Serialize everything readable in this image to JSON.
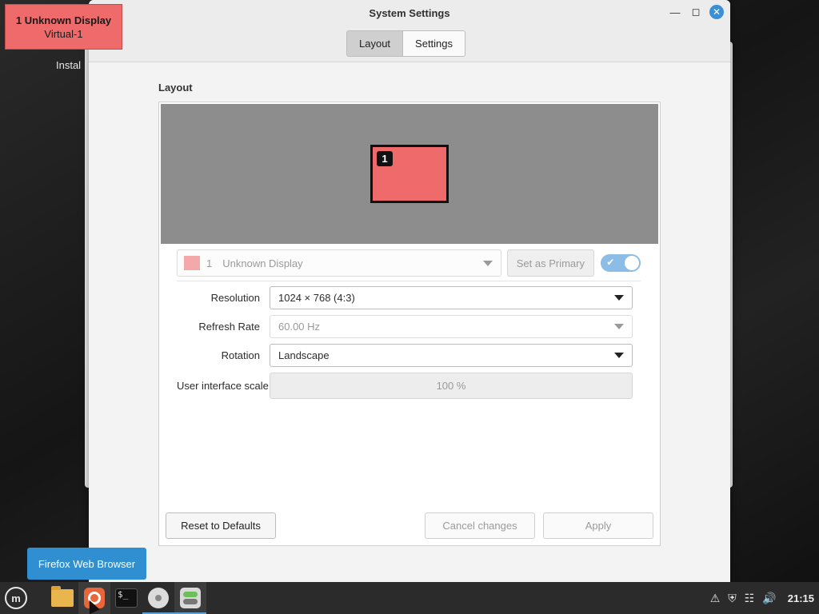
{
  "identify": {
    "title": "1  Unknown Display",
    "subtitle": "Virtual-1"
  },
  "desktop": {
    "background_label": "Instal"
  },
  "window": {
    "title": "System Settings",
    "tabs": [
      {
        "label": "Layout",
        "active": true
      },
      {
        "label": "Settings",
        "active": false
      }
    ]
  },
  "layout": {
    "section_title": "Layout",
    "monitor_number": "1",
    "display_selector": {
      "number": "1",
      "name": "Unknown Display",
      "swatch_color": "#f3a9a9"
    },
    "set_primary_label": "Set as Primary",
    "enabled": true,
    "fields": [
      {
        "label": "Resolution",
        "value": "1024 × 768 (4:3)",
        "enabled": true
      },
      {
        "label": "Refresh Rate",
        "value": "60.00 Hz",
        "enabled": false
      },
      {
        "label": "Rotation",
        "value": "Landscape",
        "enabled": true
      }
    ],
    "scale": {
      "label": "User interface scale",
      "value": "100 %"
    }
  },
  "buttons": {
    "reset": "Reset to Defaults",
    "cancel": "Cancel changes",
    "apply": "Apply"
  },
  "tooltip": "Firefox Web Browser",
  "taskbar": {
    "items": [
      "mint-menu-icon",
      "files-icon",
      "firefox-icon",
      "terminal-icon",
      "disc-icon",
      "settings-icon"
    ],
    "clock": "21:15"
  },
  "colors": {
    "accent": "#3a8fd6",
    "monitor": "#ef6b6b",
    "tooltip": "#2f8fd0"
  }
}
